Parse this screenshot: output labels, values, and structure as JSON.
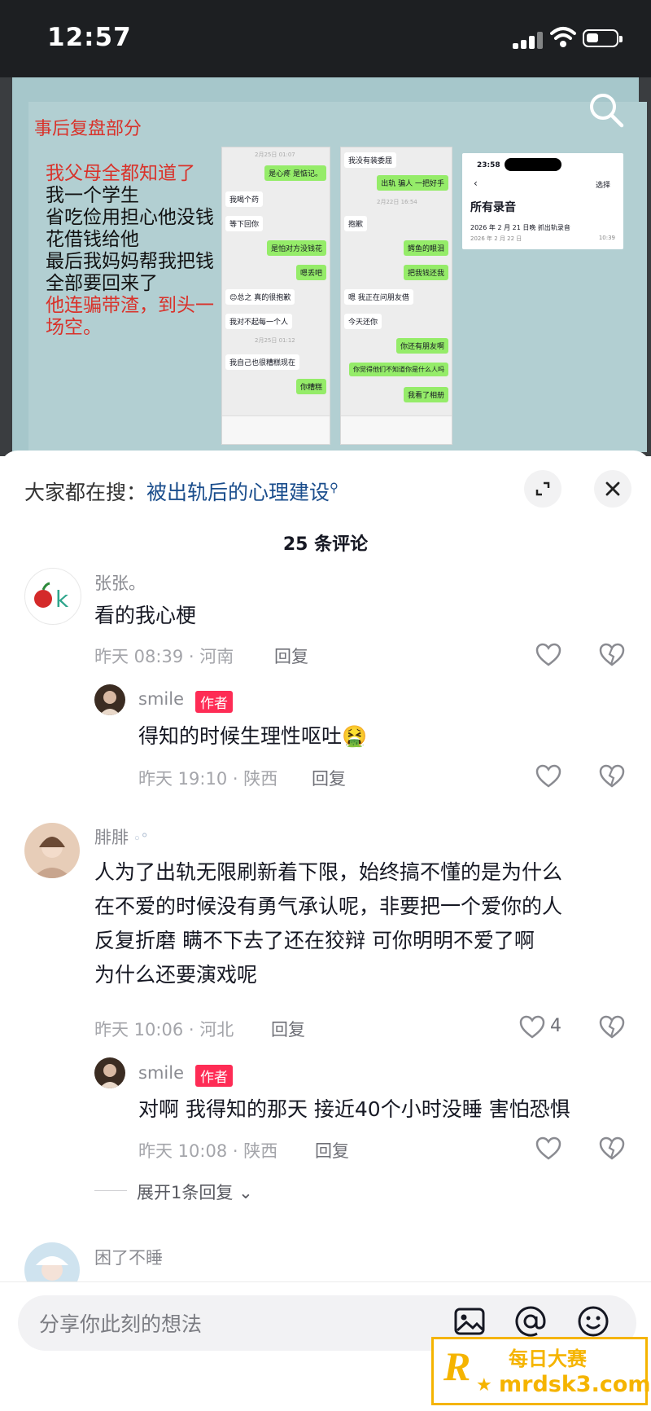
{
  "status": {
    "time": "12:57"
  },
  "video": {
    "slide_title": "事后复盘部分",
    "lines": [
      "我父母全都知道了",
      "我一个学生",
      "省吃俭用担心他没钱",
      "花借钱给他",
      "最后我妈妈帮我把钱",
      "全部要回来了"
    ],
    "red_lines": [
      "他连骗带渣，到头一",
      "场空。"
    ],
    "chat1": {
      "ts1": "2月25日 01:07",
      "g1": "是心疼 是惦记。",
      "w1": "我喝个药",
      "w2": "等下回你",
      "g2": "是怕对方没钱花",
      "g3": "嗯丢吧",
      "w3": "😊总之 真的很抱歉",
      "w4": "我对不起每一个人",
      "ts2": "2月25日 01:12",
      "w5": "我自己也很糟糕现在",
      "g4": "你糟糕"
    },
    "chat2": {
      "w1": "我没有装委屈",
      "g1": "出轨 骗人 一把好手",
      "ts1": "2月22日 16:54",
      "w2": "抱歉",
      "g2": "鳄鱼的眼泪",
      "g3": "把我钱还我",
      "w3": "嗯 我正在问朋友借",
      "w4": "今天还你",
      "g4": "你还有朋友啊",
      "g5": "你觉得他们不知道你是什么人吗",
      "g6": "我看了相册"
    },
    "recording": {
      "time": "23:58",
      "select": "选择",
      "title": "所有录音",
      "item": "2026 年 2 月 21 日晚 抓出轨录音",
      "date": "2026 年 2 月 22 日",
      "duration": "10:39"
    }
  },
  "header": {
    "hot_prefix": "大家都在搜：",
    "hot_link": "被出轨后的心理建设",
    "count": "25 条评论"
  },
  "comments": [
    {
      "name": "张张。",
      "text": "看的我心梗",
      "time": "昨天 08:39 · 河南",
      "reply": "回复"
    },
    {
      "name": "smile",
      "tag": "作者",
      "text": "得知的时候生理性呕吐🤮",
      "time": "昨天 19:10 · 陕西",
      "reply": "回复"
    },
    {
      "name": "腓腓",
      "text_lines": [
        "人为了出轨无限刷新着下限，始终搞不懂的是为什么",
        "在不爱的时候没有勇气承认呢，非要把一个爱你的人",
        "反复折磨  瞒不下去了还在狡辩  可你明明不爱了啊",
        "为什么还要演戏呢"
      ],
      "time": "昨天 10:06 · 河北",
      "reply": "回复",
      "likes": "4"
    },
    {
      "name": "smile",
      "tag": "作者",
      "text": "对啊 我得知的那天 接近40个小时没睡 害怕恐惧",
      "time": "昨天 10:08 · 陕西",
      "reply": "回复"
    },
    {
      "name": "困了不睡"
    }
  ],
  "expand": "展开1条回复",
  "input": {
    "placeholder": "分享你此刻的想法"
  },
  "watermark": {
    "line1": "每日大赛",
    "line2": "mrdsk3.com",
    "logo": "R"
  }
}
